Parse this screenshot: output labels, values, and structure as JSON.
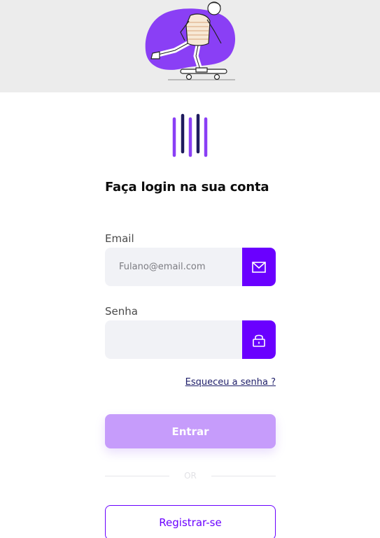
{
  "hero": {
    "illustration": "skateboarder-illustration",
    "blob_color": "#8a3ff5"
  },
  "logo": {
    "name": "bars-logo",
    "colors": [
      "#8a3ff5",
      "#1e1b5e"
    ]
  },
  "login": {
    "title": "Faça login na sua conta",
    "email_label": "Email",
    "email_placeholder": "Fulano@email.com",
    "email_icon": "envelope-icon",
    "password_label": "Senha",
    "password_placeholder": "",
    "password_icon": "lock-icon",
    "forgot_link": "Esqueceu a senha ?",
    "submit_label": "Entrar",
    "divider_text": "OR",
    "register_label": "Registrar-se"
  },
  "colors": {
    "accent": "#6a00ff",
    "submit_disabled": "#c69cfb",
    "field_bg": "#f1f2f6",
    "link": "#1f1f6a"
  }
}
